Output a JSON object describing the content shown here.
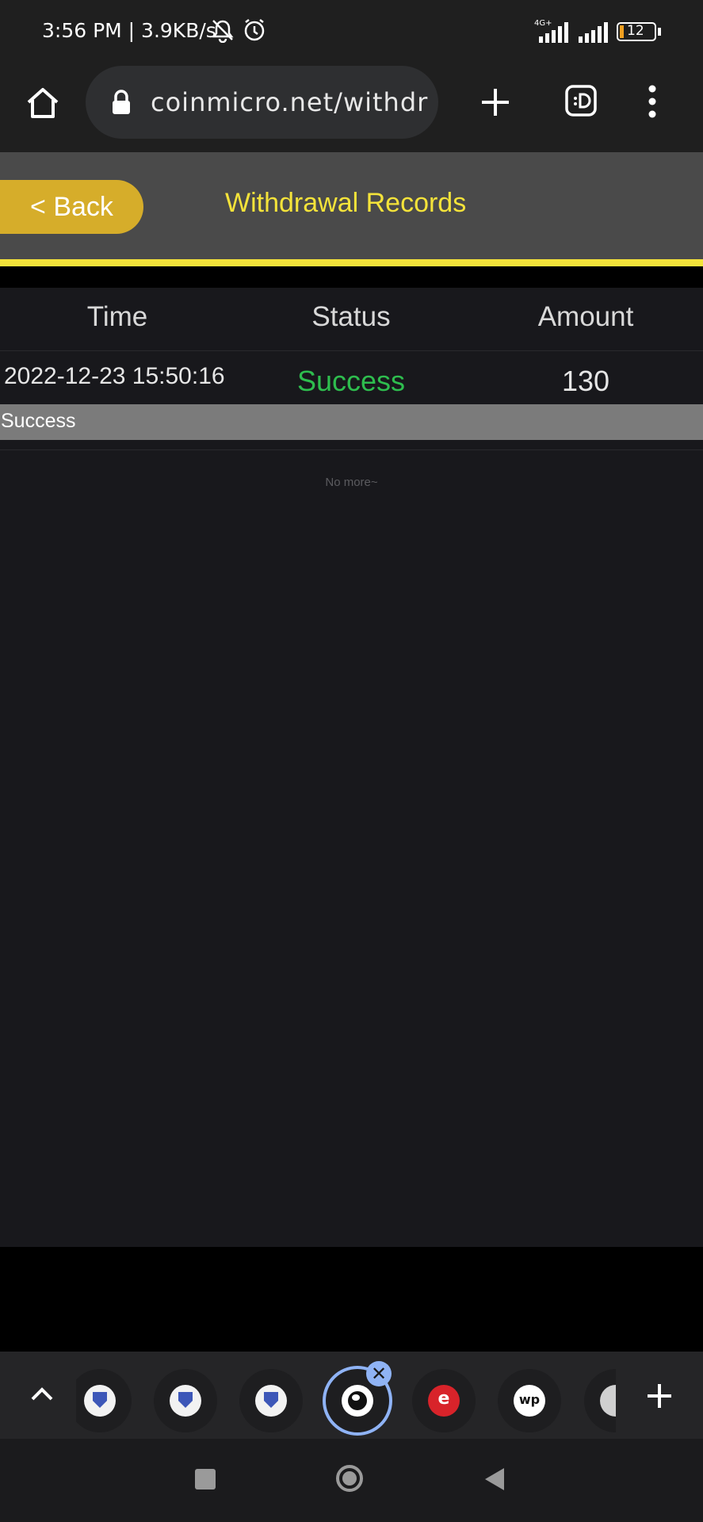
{
  "status_bar": {
    "time": "3:56 PM | 3.9KB/s",
    "network_label": "4G+",
    "battery": "12"
  },
  "browser": {
    "url": "coinmicro.net/withdr"
  },
  "header": {
    "back_label": "< Back",
    "title": "Withdrawal Records"
  },
  "table": {
    "columns": [
      "Time",
      "Status",
      "Amount"
    ],
    "rows": [
      {
        "time": "2022-12-23 15:50:16",
        "status": "Success",
        "amount": "130",
        "detail": "Success"
      }
    ],
    "footer": "No more~"
  },
  "colors": {
    "accent_yellow": "#f4e33a",
    "back_button": "#d6ad2a",
    "success_green": "#2ebd4e"
  },
  "tabs": {
    "favicons": [
      "shield-favicon",
      "shield-favicon",
      "shield-favicon",
      "globe-favicon",
      "e-favicon",
      "wp-favicon",
      "partial-favicon"
    ],
    "wp_label": "wp",
    "e_label": "e"
  }
}
